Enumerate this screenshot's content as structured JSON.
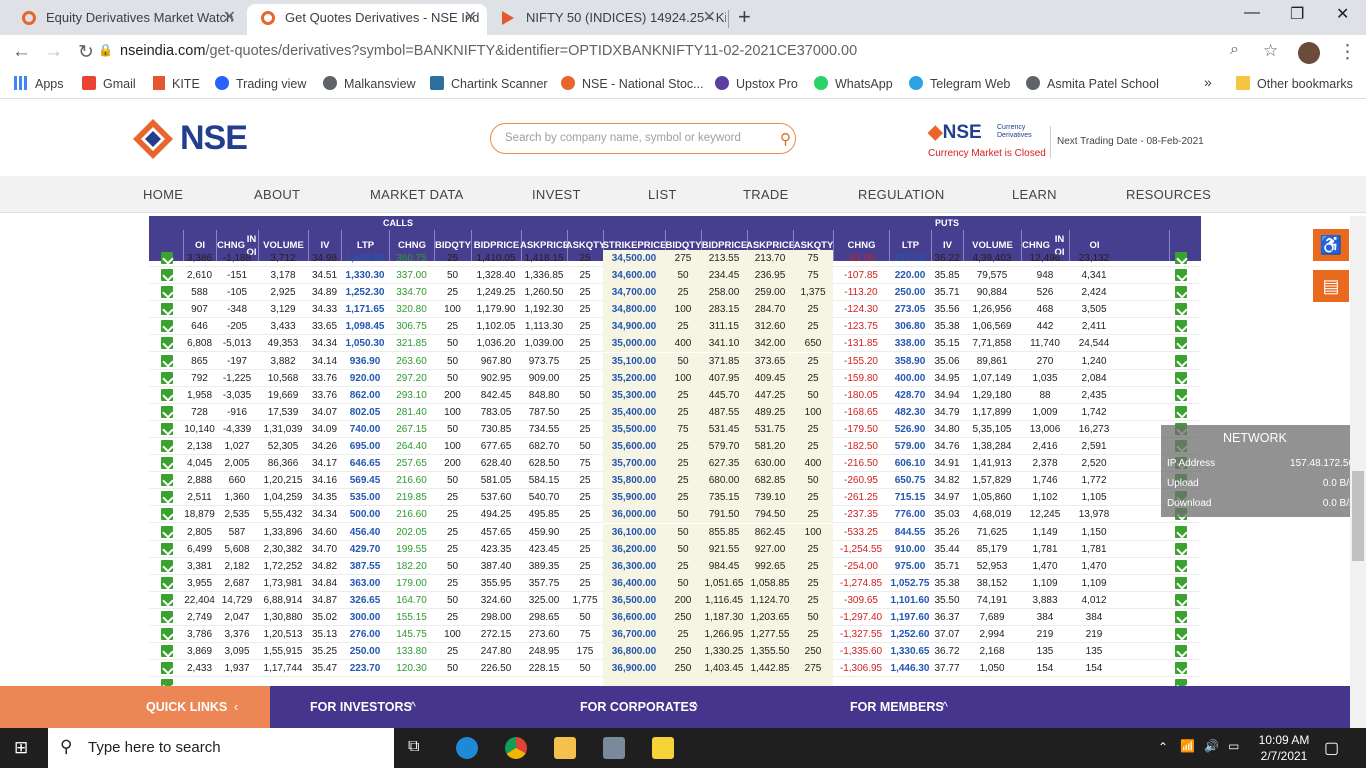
{
  "browser": {
    "tabs": [
      {
        "title": "Equity Derivatives Market Watch",
        "fav_color": "#e8652c"
      },
      {
        "title": "Get Quotes Derivatives - NSE Ind",
        "fav_color": "#e8652c"
      },
      {
        "title": "NIFTY 50 (INDICES) 14924.25 - Ki",
        "fav_color": "#e4572e"
      }
    ],
    "url_host": "nseindia.com",
    "url_path": "/get-quotes/derivatives?symbol=BANKNIFTY&identifier=OPTIDXBANKNIFTY11-02-2021CE37000.00",
    "bookmarks": [
      "Apps",
      "Gmail",
      "KITE",
      "Trading view",
      "Malkansview",
      "Chartink Scanner",
      "NSE - National Stoc...",
      "Upstox Pro",
      "WhatsApp",
      "Telegram Web",
      "Asmita Patel School"
    ],
    "other_bookmarks": "Other bookmarks",
    "more": "»"
  },
  "nse": {
    "logo": "NSE",
    "search_placeholder": "Search by company name, symbol or keyword",
    "currency_logo": "NSE",
    "currency_sub1": "Currency",
    "currency_sub2": "Derivatives",
    "currency_status": "Currency Market is Closed",
    "next_trading": "Next Trading Date - 08-Feb-2021",
    "menu": [
      "HOME",
      "ABOUT",
      "MARKET DATA",
      "INVEST",
      "LIST",
      "TRADE",
      "REGULATION",
      "LEARN",
      "RESOURCES"
    ]
  },
  "table": {
    "calls_label": "CALLS",
    "puts_label": "PUTS",
    "headers": [
      [
        "OI"
      ],
      [
        "CHNG",
        "IN OI"
      ],
      [
        "VOLUME"
      ],
      [
        "IV"
      ],
      [
        "LTP"
      ],
      [
        "CHNG"
      ],
      [
        "BID",
        "QTY"
      ],
      [
        "BID",
        "PRICE"
      ],
      [
        "ASK",
        "PRICE"
      ],
      [
        "ASK",
        "QTY"
      ],
      [
        "STRIKE",
        "PRICE"
      ],
      [
        "BID",
        "QTY"
      ],
      [
        "BID",
        "PRICE"
      ],
      [
        "ASK",
        "PRICE"
      ],
      [
        "ASK",
        "QTY"
      ],
      [
        "CHNG"
      ],
      [
        "LTP"
      ],
      [
        "IV"
      ],
      [
        "VOLUME"
      ],
      [
        "CHNG",
        "IN OI"
      ],
      [
        "OI"
      ]
    ],
    "partial_top": [
      "3,386",
      "-1,188",
      "3,712",
      "34.98",
      "1,430.00",
      "360.75",
      "25",
      "1,410.05",
      "1,418.15",
      "25",
      "34,500.00",
      "275",
      "213.55",
      "213.70",
      "75",
      "-81.00",
      "217.00",
      "36.22",
      "4,39,403",
      "12,496",
      "23,132"
    ],
    "rows": [
      [
        "2,610",
        "-151",
        "3,178",
        "34.51",
        "1,330.30",
        "337.00",
        "50",
        "1,328.40",
        "1,336.85",
        "25",
        "34,600.00",
        "50",
        "234.45",
        "236.95",
        "75",
        "-107.85",
        "220.00",
        "35.85",
        "79,575",
        "948",
        "4,341"
      ],
      [
        "588",
        "-105",
        "2,925",
        "34.89",
        "1,252.30",
        "334.70",
        "25",
        "1,249.25",
        "1,260.50",
        "25",
        "34,700.00",
        "25",
        "258.00",
        "259.00",
        "1,375",
        "-113.20",
        "250.00",
        "35.71",
        "90,884",
        "526",
        "2,424"
      ],
      [
        "907",
        "-348",
        "3,129",
        "34.33",
        "1,171.65",
        "320.80",
        "100",
        "1,179.90",
        "1,192.30",
        "25",
        "34,800.00",
        "100",
        "283.15",
        "284.70",
        "25",
        "-124.30",
        "273.05",
        "35.56",
        "1,26,956",
        "468",
        "3,505"
      ],
      [
        "646",
        "-205",
        "3,433",
        "33.65",
        "1,098.45",
        "306.75",
        "25",
        "1,102.05",
        "1,113.30",
        "25",
        "34,900.00",
        "25",
        "311.15",
        "312.60",
        "25",
        "-123.75",
        "306.80",
        "35.38",
        "1,06,569",
        "442",
        "2,411"
      ],
      [
        "6,808",
        "-5,013",
        "49,353",
        "34.34",
        "1,050.30",
        "321.85",
        "50",
        "1,036.20",
        "1,039.00",
        "25",
        "35,000.00",
        "400",
        "341.10",
        "342.00",
        "650",
        "-131.85",
        "338.00",
        "35.15",
        "7,71,858",
        "11,740",
        "24,544"
      ],
      [
        "865",
        "-197",
        "3,882",
        "34.14",
        "936.90",
        "263.60",
        "50",
        "967.80",
        "973.75",
        "25",
        "35,100.00",
        "50",
        "371.85",
        "373.65",
        "25",
        "-155.20",
        "358.90",
        "35.06",
        "89,861",
        "270",
        "1,240"
      ],
      [
        "792",
        "-1,225",
        "10,568",
        "33.76",
        "920.00",
        "297.20",
        "50",
        "902.95",
        "909.00",
        "25",
        "35,200.00",
        "100",
        "407.95",
        "409.45",
        "25",
        "-159.80",
        "400.00",
        "34.95",
        "1,07,149",
        "1,035",
        "2,084"
      ],
      [
        "1,958",
        "-3,035",
        "19,669",
        "33.76",
        "862.00",
        "293.10",
        "200",
        "842.45",
        "848.80",
        "50",
        "35,300.00",
        "25",
        "445.70",
        "447.25",
        "50",
        "-180.05",
        "428.70",
        "34.94",
        "1,29,180",
        "88",
        "2,435"
      ],
      [
        "728",
        "-916",
        "17,539",
        "34.07",
        "802.05",
        "281.40",
        "100",
        "783.05",
        "787.50",
        "25",
        "35,400.00",
        "25",
        "487.55",
        "489.25",
        "100",
        "-168.65",
        "482.30",
        "34.79",
        "1,17,899",
        "1,009",
        "1,742"
      ],
      [
        "10,140",
        "-4,339",
        "1,31,039",
        "34.09",
        "740.00",
        "267.15",
        "50",
        "730.85",
        "734.55",
        "25",
        "35,500.00",
        "75",
        "531.45",
        "531.75",
        "25",
        "-179.50",
        "526.90",
        "34.80",
        "5,35,105",
        "13,006",
        "16,273"
      ],
      [
        "2,138",
        "1,027",
        "52,305",
        "34.26",
        "695.00",
        "264.40",
        "100",
        "677.65",
        "682.70",
        "50",
        "35,600.00",
        "25",
        "579.70",
        "581.20",
        "25",
        "-182.50",
        "579.00",
        "34.76",
        "1,38,284",
        "2,416",
        "2,591"
      ],
      [
        "4,045",
        "2,005",
        "86,366",
        "34.17",
        "646.65",
        "257.65",
        "200",
        "628.40",
        "628.50",
        "75",
        "35,700.00",
        "25",
        "627.35",
        "630.00",
        "400",
        "-216.50",
        "606.10",
        "34.91",
        "1,41,913",
        "2,378",
        "2,520"
      ],
      [
        "2,888",
        "660",
        "1,20,215",
        "34.16",
        "569.45",
        "216.60",
        "50",
        "581.05",
        "584.15",
        "25",
        "35,800.00",
        "25",
        "680.00",
        "682.85",
        "50",
        "-260.95",
        "650.75",
        "34.82",
        "1,57,829",
        "1,746",
        "1,772"
      ],
      [
        "2,511",
        "1,360",
        "1,04,259",
        "34.35",
        "535.00",
        "219.85",
        "25",
        "537.60",
        "540.70",
        "25",
        "35,900.00",
        "25",
        "735.15",
        "739.10",
        "25",
        "-261.25",
        "715.15",
        "34.97",
        "1,05,860",
        "1,102",
        "1,105"
      ],
      [
        "18,879",
        "2,535",
        "5,55,432",
        "34.34",
        "500.00",
        "216.60",
        "25",
        "494.25",
        "495.85",
        "25",
        "36,000.00",
        "50",
        "791.50",
        "794.50",
        "25",
        "-237.35",
        "776.00",
        "35.03",
        "4,68,019",
        "12,245",
        "13,978"
      ],
      [
        "2,805",
        "587",
        "1,33,896",
        "34.60",
        "456.40",
        "202.05",
        "25",
        "457.65",
        "459.90",
        "25",
        "36,100.00",
        "50",
        "855.85",
        "862.45",
        "100",
        "-533.25",
        "844.55",
        "35.26",
        "71,625",
        "1,149",
        "1,150"
      ],
      [
        "6,499",
        "5,608",
        "2,30,382",
        "34.70",
        "429.70",
        "199.55",
        "25",
        "423.35",
        "423.45",
        "25",
        "36,200.00",
        "50",
        "921.55",
        "927.00",
        "25",
        "-1,254.55",
        "910.00",
        "35.44",
        "85,179",
        "1,781",
        "1,781"
      ],
      [
        "3,381",
        "2,182",
        "1,72,252",
        "34.82",
        "387.55",
        "182.20",
        "50",
        "387.40",
        "389.35",
        "25",
        "36,300.00",
        "25",
        "984.45",
        "992.65",
        "25",
        "-254.00",
        "975.00",
        "35.71",
        "52,953",
        "1,470",
        "1,470"
      ],
      [
        "3,955",
        "2,687",
        "1,73,981",
        "34.84",
        "363.00",
        "179.00",
        "25",
        "355.95",
        "357.75",
        "25",
        "36,400.00",
        "50",
        "1,051.65",
        "1,058.85",
        "25",
        "-1,274.85",
        "1,052.75",
        "35.38",
        "38,152",
        "1,109",
        "1,109"
      ],
      [
        "22,404",
        "14,729",
        "6,88,914",
        "34.87",
        "326.65",
        "164.70",
        "50",
        "324.60",
        "325.00",
        "1,775",
        "36,500.00",
        "200",
        "1,116.45",
        "1,124.70",
        "25",
        "-309.65",
        "1,101.60",
        "35.50",
        "74,191",
        "3,883",
        "4,012"
      ],
      [
        "2,749",
        "2,047",
        "1,30,880",
        "35.02",
        "300.00",
        "155.15",
        "25",
        "298.00",
        "298.65",
        "50",
        "36,600.00",
        "250",
        "1,187.30",
        "1,203.65",
        "50",
        "-1,297.40",
        "1,197.60",
        "36.37",
        "7,689",
        "384",
        "384"
      ],
      [
        "3,786",
        "3,376",
        "1,20,513",
        "35.13",
        "276.00",
        "145.75",
        "100",
        "272.15",
        "273.60",
        "75",
        "36,700.00",
        "25",
        "1,266.95",
        "1,277.55",
        "25",
        "-1,327.55",
        "1,252.60",
        "37.07",
        "2,994",
        "219",
        "219"
      ],
      [
        "3,869",
        "3,095",
        "1,55,915",
        "35.25",
        "250.00",
        "133.80",
        "25",
        "247.80",
        "248.95",
        "175",
        "36,800.00",
        "250",
        "1,330.25",
        "1,355.50",
        "250",
        "-1,335.60",
        "1,330.65",
        "36.72",
        "2,168",
        "135",
        "135"
      ],
      [
        "2,433",
        "1,937",
        "1,17,744",
        "35.47",
        "223.70",
        "120.30",
        "50",
        "226.50",
        "228.15",
        "50",
        "36,900.00",
        "250",
        "1,403.45",
        "1,442.85",
        "275",
        "-1,306.95",
        "1,446.30",
        "37.77",
        "1,050",
        "154",
        "154"
      ]
    ]
  },
  "network": {
    "title": "NETWORK",
    "ip_label": "IP Address",
    "ip": "157.48.172.56",
    "up_label": "Upload",
    "up": "0.0 B/s",
    "down_label": "Download",
    "down": "0.0 B/s"
  },
  "footer": {
    "quick": "QUICK LINKS",
    "investors": "FOR INVESTORS",
    "corporates": "FOR CORPORATES",
    "members": "FOR MEMBERS"
  },
  "taskbar": {
    "search": "Type here to search",
    "time": "10:09 AM",
    "date": "2/7/2021"
  }
}
